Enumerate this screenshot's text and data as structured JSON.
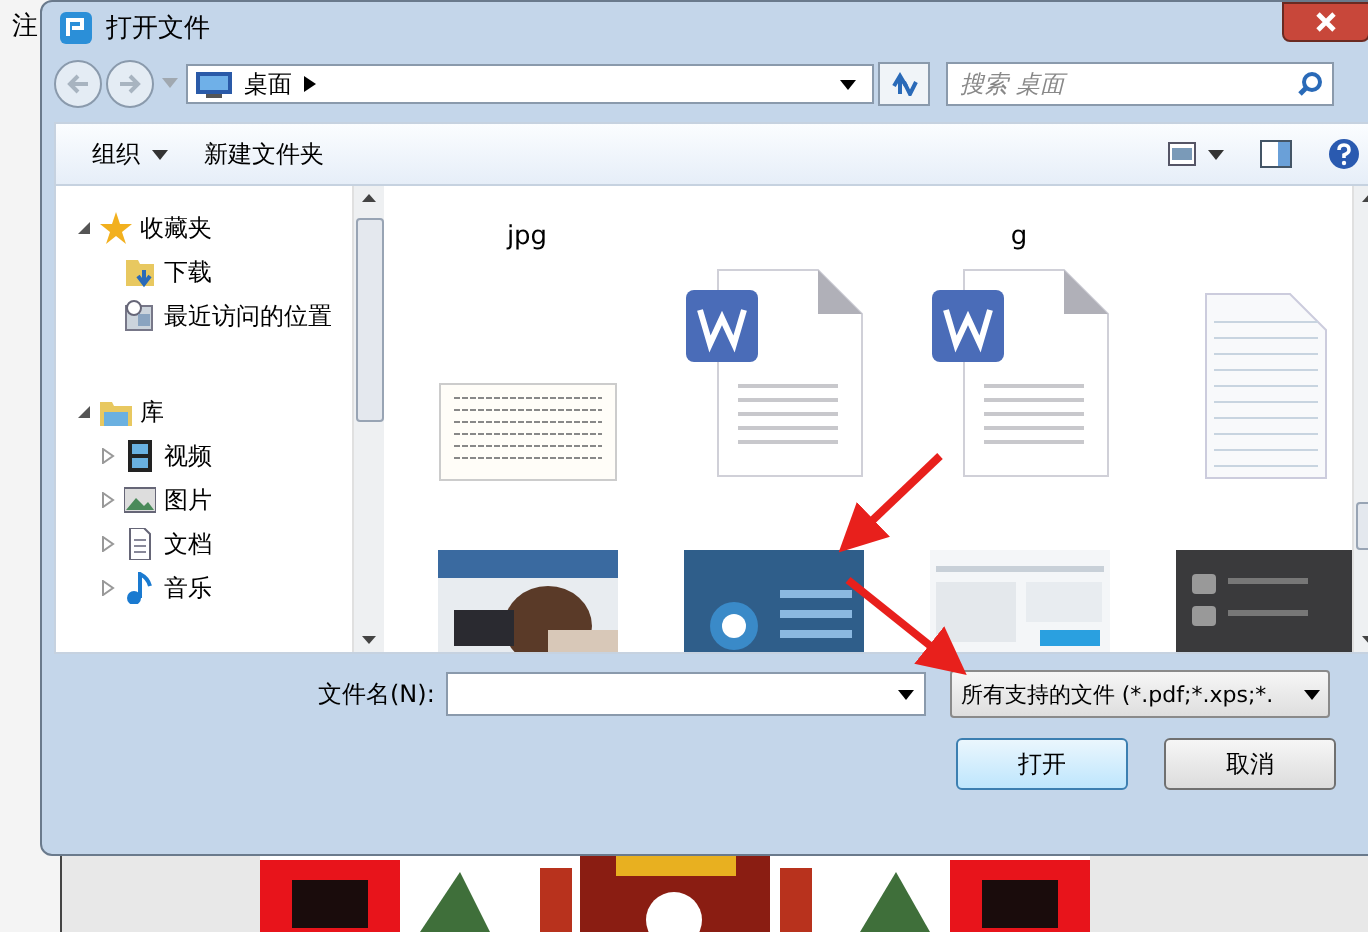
{
  "background_app": {
    "label": "注"
  },
  "window": {
    "title": "打开文件"
  },
  "address_bar": {
    "path": "桌面"
  },
  "search": {
    "placeholder": "搜索 桌面"
  },
  "toolbar": {
    "organize": "组织",
    "new_folder": "新建文件夹"
  },
  "sidebar": {
    "groups": [
      {
        "label": "收藏夹",
        "expanded": true,
        "children": [
          {
            "label": "下载"
          },
          {
            "label": "最近访问的位置"
          }
        ]
      },
      {
        "label": "库",
        "expanded": true,
        "children": [
          {
            "label": "视频",
            "expanded": false
          },
          {
            "label": "图片",
            "expanded": false
          },
          {
            "label": "文档",
            "expanded": false
          },
          {
            "label": "音乐",
            "expanded": false
          }
        ]
      }
    ]
  },
  "files": [
    {
      "kind": "scan",
      "caption": "jpg"
    },
    {
      "kind": "wps"
    },
    {
      "kind": "wps",
      "caption": "g"
    },
    {
      "kind": "text"
    },
    {
      "kind": "picture"
    },
    {
      "kind": "picture"
    },
    {
      "kind": "picture"
    },
    {
      "kind": "picture"
    }
  ],
  "filename": {
    "label": "文件名(N):"
  },
  "filetype": {
    "value": "所有支持的文件 (*.pdf;*.xps;*."
  },
  "buttons": [
    {
      "label": "打开",
      "default": true
    },
    {
      "label": "取消",
      "default": false
    }
  ]
}
